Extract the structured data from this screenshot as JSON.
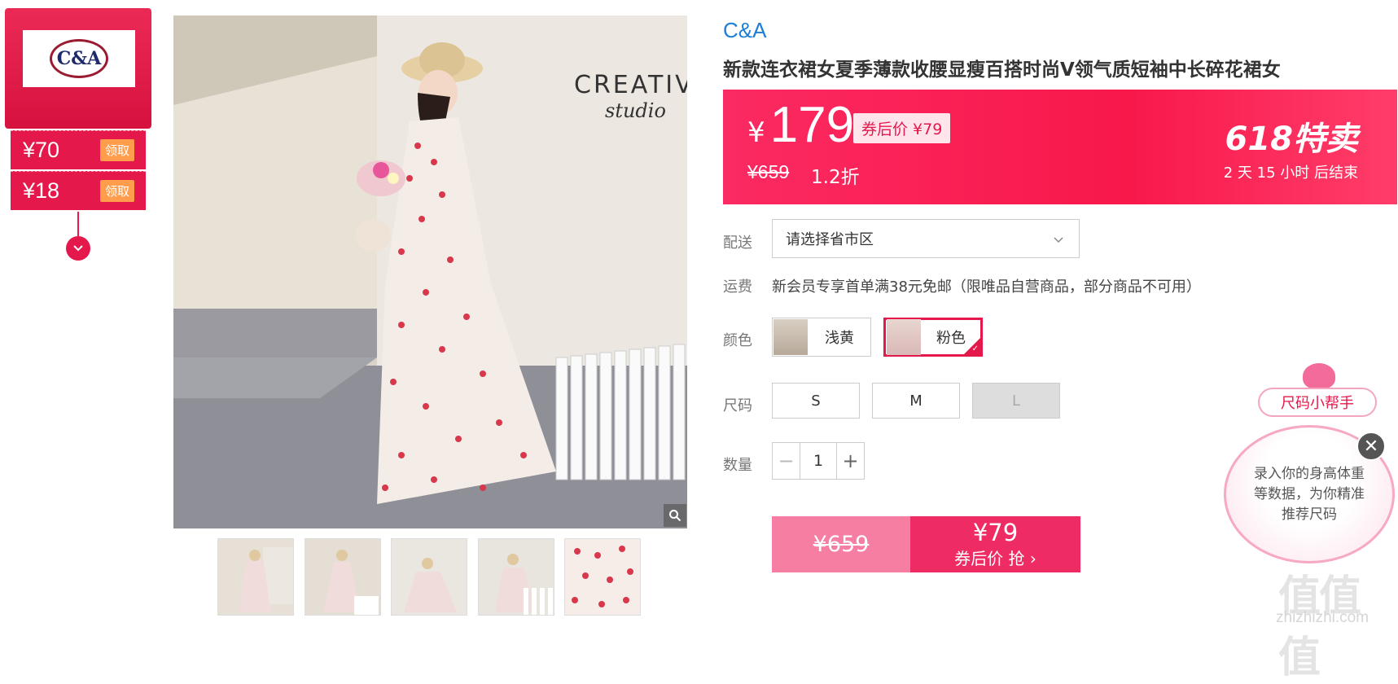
{
  "left_panel": {
    "brand_logo_text": "C&A",
    "coupons": [
      {
        "amount": "¥70",
        "button": "领取"
      },
      {
        "amount": "¥18",
        "button": "领取"
      }
    ]
  },
  "product": {
    "brand": "C&A",
    "title": "新款连衣裙女夏季薄款收腰显瘦百搭时尚V领气质短袖中长碎花裙女",
    "photo_text_line1": "CREATIV",
    "photo_text_line2": "studio"
  },
  "price_band": {
    "currency": "¥",
    "price": "179",
    "after_coupon_tag": "券后价 ¥79",
    "original_price": "¥659",
    "discount": "1.2折",
    "promo_title": "618特卖",
    "countdown": "2 天 15 小时 后结束"
  },
  "delivery": {
    "label": "配送",
    "placeholder": "请选择省市区"
  },
  "shipping": {
    "label": "运费",
    "text": "新会员专享首单满38元免邮（限唯品自营商品，部分商品不可用）"
  },
  "color": {
    "label": "颜色",
    "options": [
      {
        "name": "浅黄",
        "selected": false
      },
      {
        "name": "粉色",
        "selected": true
      }
    ]
  },
  "size": {
    "label": "尺码",
    "options": [
      {
        "name": "S",
        "available": true
      },
      {
        "name": "M",
        "available": true
      },
      {
        "name": "L",
        "available": false
      }
    ]
  },
  "quantity": {
    "label": "数量",
    "value": "1",
    "minus": "−",
    "plus": "+"
  },
  "buy": {
    "original": "¥659",
    "after_price": "¥79",
    "action": "券后价 抢 ›"
  },
  "size_helper": {
    "button": "尺码小帮手",
    "bubble": "录入你的身高体重等数据，为你精准推荐尺码",
    "close": "✕"
  },
  "watermark": {
    "text": "值值值",
    "url": "zhizhizhi.com"
  },
  "colors": {
    "accent": "#e4184a",
    "brand_link": "#1b7fd8",
    "price_band": "#fb2a62"
  }
}
